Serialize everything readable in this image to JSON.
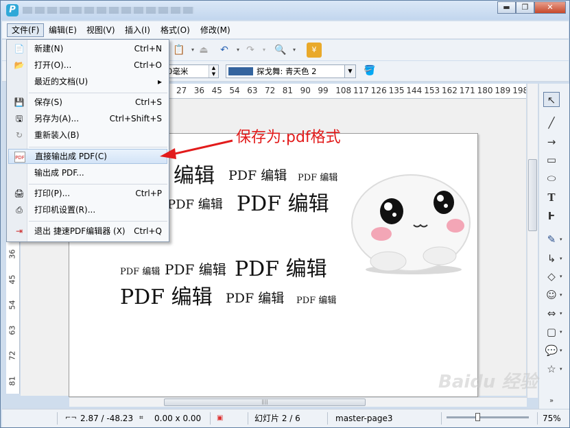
{
  "menubar": {
    "items": [
      "文件(F)",
      "编辑(E)",
      "视图(V)",
      "插入(I)",
      "格式(O)",
      "修改(M)"
    ]
  },
  "toolbar2": {
    "size_value": "0毫米",
    "color_name": "探戈舞: 青天色 2",
    "color_hex": "#35649e"
  },
  "ruler": {
    "h_ticks": [
      "27",
      "36",
      "45",
      "54",
      "63",
      "72",
      "81",
      "90",
      "99",
      "108",
      "117",
      "126",
      "135",
      "144",
      "153",
      "162",
      "171",
      "180",
      "189",
      "198"
    ],
    "v_ticks": [
      "36",
      "45",
      "54",
      "63",
      "72",
      "81"
    ]
  },
  "file_menu": {
    "items": [
      {
        "label": "新建(N)",
        "shortcut": "Ctrl+N",
        "icon": "new-doc-icon"
      },
      {
        "label": "打开(O)...",
        "shortcut": "Ctrl+O",
        "icon": "folder-open-icon"
      },
      {
        "label": "最近的文档(U)",
        "shortcut": "▸",
        "icon": ""
      },
      {
        "label": "保存(S)",
        "shortcut": "Ctrl+S",
        "icon": "save-icon"
      },
      {
        "label": "另存为(A)...",
        "shortcut": "Ctrl+Shift+S",
        "icon": "save-as-icon"
      },
      {
        "label": "重新装入(B)",
        "shortcut": "",
        "icon": "reload-icon"
      },
      {
        "label": "直接输出成 PDF(C)",
        "shortcut": "",
        "icon": "pdf-icon"
      },
      {
        "label": "输出成 PDF...",
        "shortcut": "",
        "icon": ""
      },
      {
        "label": "打印(P)...",
        "shortcut": "Ctrl+P",
        "icon": "print-icon"
      },
      {
        "label": "打印机设置(R)...",
        "shortcut": "",
        "icon": "printer-settings-icon"
      },
      {
        "label": "退出 捷速PDF编辑器 (X)",
        "shortcut": "Ctrl+Q",
        "icon": "exit-icon"
      }
    ]
  },
  "annotation": {
    "text": "保存为.pdf格式",
    "color": "#e21b1b"
  },
  "slide": {
    "lines": [
      "编辑 PDF 编辑 PDF 编辑",
      "PDF 编辑 PDF 编辑",
      "PDF 编辑 PDF 编辑 PDF 编辑",
      "PDF 编辑 PDF 编辑 PDF 编辑"
    ],
    "fragments": {
      "l1a": "编辑",
      "l1b": "PDF 编辑",
      "l1c": "PDF 编辑",
      "l2a": "PDF 编辑",
      "l2b": "PDF 编辑",
      "l3a": "PDF 编辑",
      "l3b": "PDF 编辑",
      "l3c": "PDF 编辑",
      "l4a": "PDF 编辑",
      "l4b": "PDF 编辑",
      "l4c": "PDF 编辑"
    }
  },
  "statusbar": {
    "position": "2.87 / -48.23",
    "size": "0.00 x 0.00",
    "slide_info": "幻灯片 2 / 6",
    "master": "master-page3",
    "zoom": "75%"
  },
  "watermark": {
    "text": "Baidu 经验"
  }
}
